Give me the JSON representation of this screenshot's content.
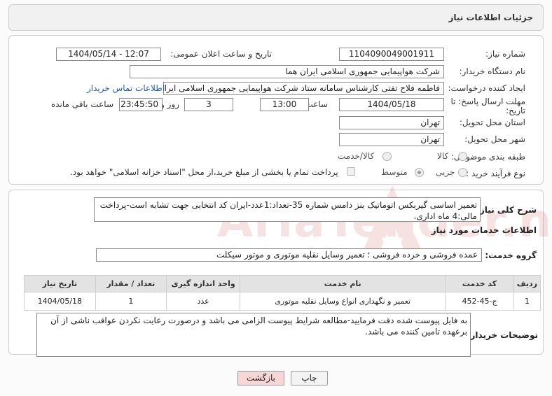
{
  "header": {
    "title": "جزئیات اطلاعات نیاز"
  },
  "form": {
    "need_number_label": "شماره نیاز:",
    "need_number": "1104090049001911",
    "announce_label": "تاریخ و ساعت اعلان عمومی:",
    "announce_value": "1404/05/14 - 12:07",
    "buyer_org_label": "نام دستگاه خریدار:",
    "buyer_org": "شرکت هواپیمایی جمهوری اسلامی ایران هما",
    "requester_label": "ایجاد کننده درخواست:",
    "requester": "فاطمه فلاح تفتی کارشناس سامانه ستاد شرکت هواپیمایی جمهوری اسلامی ایران",
    "contact_link": "اطلاعات تماس خریدار",
    "deadline_label_line1": "مهلت ارسال پاسخ: تا",
    "deadline_label_line2": "تاریخ:",
    "deadline_date": "1404/05/18",
    "time_label": "ساعت",
    "deadline_time": "13:00",
    "days_value": "3",
    "days_label": "روز و",
    "remaining_time": "23:45:50",
    "remaining_label": "ساعت باقی مانده",
    "province_label": "استان محل تحویل:",
    "province": "تهران",
    "city_label": "شهر محل تحویل:",
    "city": "تهران",
    "category_label": "طبقه بندی موضوعی:",
    "category_options": [
      "کالا",
      "کالا/خدمت"
    ],
    "purchase_type_label": "نوع فرآیند خرید :",
    "purchase_type_options": [
      "جزیی",
      "متوسط"
    ],
    "payment_note": "پرداخت تمام یا بخشی از مبلغ خرید،از محل \"اسناد خزانه اسلامی\" خواهد بود."
  },
  "summary": {
    "label": "شرح کلی نیاز:",
    "text": "تعمیر اساسی گیربکس اتوماتیک بنز دامس شماره 35-تعداد:1عدد-ایران کد انتخابی جهت تشابه است-پرداخت مالی:4 ماه اداری."
  },
  "services": {
    "section_title": "اطلاعات خدمات مورد نیاز",
    "group_label": "گروه خدمت:",
    "group_value": "عمده فروشی و خرده فروشی ؛ تعمیر وسایل نقلیه موتوری و موتور سیکلت",
    "columns": [
      "ردیف",
      "کد خدمت",
      "نام خدمت",
      "واحد اندازه گیری",
      "تعداد / مقدار",
      "تاریخ نیاز"
    ],
    "rows": [
      [
        "1",
        "ج-45-452",
        "تعمیر و نگهداری انواع وسایل نقلیه موتوری",
        "عدد",
        "1",
        "1404/05/18"
      ]
    ]
  },
  "notes": {
    "label": "توضیحات خریدار:",
    "text": "به فایل پیوست شده دقت فرمایید-مطالعه شرایط پیوست الزامی می باشد و درصورت رعایت نکردن عواقب ناشی از آن برعهده تامین کننده می باشد."
  },
  "buttons": {
    "print": "چاپ",
    "back": "بازگشت"
  },
  "watermark": {
    "text": "AriaTender.net"
  },
  "colors": {
    "link": "#1a62b3",
    "back_button_bg": "#f7d6d6",
    "header_bg": "#f1f1f1",
    "watermark": "#c62828"
  }
}
